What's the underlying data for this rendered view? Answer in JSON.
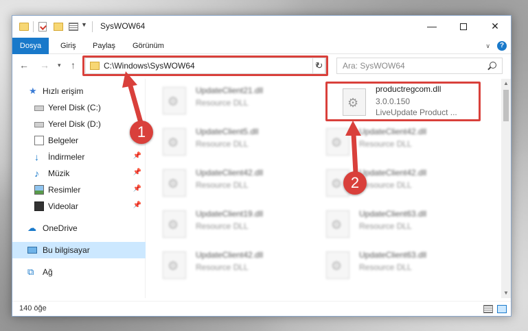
{
  "window": {
    "title": "SysWOW64"
  },
  "ribbon": {
    "tabs": [
      "Dosya",
      "Giriş",
      "Paylaş",
      "Görünüm"
    ]
  },
  "navbar": {
    "address": "C:\\Windows\\SysWOW64",
    "search_placeholder": "Ara: SysWOW64"
  },
  "sidebar": {
    "items": [
      {
        "label": "Hızlı erişim",
        "icon": "star-icon"
      },
      {
        "label": "Yerel Disk (C:)",
        "icon": "drive-icon"
      },
      {
        "label": "Yerel Disk (D:)",
        "icon": "drive-icon"
      },
      {
        "label": "Belgeler",
        "icon": "document-icon"
      },
      {
        "label": "İndirmeler",
        "icon": "download-icon"
      },
      {
        "label": "Müzik",
        "icon": "music-icon"
      },
      {
        "label": "Resimler",
        "icon": "pictures-icon"
      },
      {
        "label": "Videolar",
        "icon": "videos-icon"
      },
      {
        "label": "OneDrive",
        "icon": "cloud-icon"
      },
      {
        "label": "Bu bilgisayar",
        "icon": "computer-icon"
      },
      {
        "label": "Ağ",
        "icon": "network-icon"
      }
    ]
  },
  "files": {
    "left": [
      {
        "name": "UpdateClient21.dll",
        "desc": "Resource DLL"
      },
      {
        "name": "UpdateClient5.dll",
        "desc": "Resource DLL"
      },
      {
        "name": "UpdateClient42.dll",
        "desc": "Resource DLL"
      },
      {
        "name": "UpdateClient19.dll",
        "desc": "Resource DLL"
      },
      {
        "name": "UpdateClient42.dll",
        "desc": "Resource DLL"
      }
    ],
    "target": {
      "name": "productregcom.dll",
      "version": "3.0.0.150",
      "desc": "LiveUpdate Product ..."
    },
    "right": [
      {
        "name": "UpdateClient42.dll",
        "desc": "Resource DLL"
      },
      {
        "name": "UpdateClient42.dll",
        "desc": "Resource DLL"
      },
      {
        "name": "UpdateClient63.dll",
        "desc": "Resource DLL"
      },
      {
        "name": "UpdateClient63.dll",
        "desc": "Resource DLL"
      }
    ]
  },
  "status": {
    "count": "140 öğe"
  },
  "annotations": {
    "step1": "1",
    "step2": "2"
  },
  "colors": {
    "accent": "#1979ca",
    "highlight": "#d9403b"
  }
}
